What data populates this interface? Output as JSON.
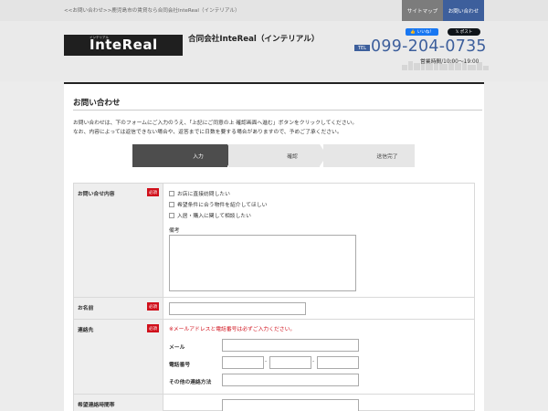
{
  "topbar": {
    "breadcrumb": "<<お問い合わせ>>鹿児島市の賃貸なら合同会社InteReal（インテリアル）",
    "sitemap_label": "サイトマップ",
    "contact_label": "お問い合わせ"
  },
  "header": {
    "logo_sub": "インテリアル",
    "logo_text": "InteReal",
    "company_name": "合同会社InteReal（インテリアル）",
    "fb_like": "いいね！",
    "x_post": "ポスト",
    "tel_badge": "TEL",
    "tel_number": "099-204-0735",
    "hours": "営業時間/10:00～19:00",
    "colors": {
      "accent": "#3d5f9c",
      "dark": "#1f1f1f"
    }
  },
  "main": {
    "title": "お問い合わせ",
    "intro_line1": "お問い合わせは、下のフォームにご入力のうえ、「上記にご同意の上 確認画面へ進む」ボタンをクリックしてください。",
    "intro_line2": "なお、内容によっては返信できない場合や、返答までに日数を要する場合がありますので、予めご了承ください。",
    "steps": [
      "入力",
      "確認",
      "送信完了"
    ]
  },
  "form": {
    "required_label": "必須",
    "inquiry": {
      "label": "お問い合せ内容",
      "options": [
        "お店に直接訪問したい",
        "希望条件に合う物件を紹介してほしい",
        "入居・購入に関して相談したい"
      ],
      "note_label": "備考"
    },
    "name": {
      "label": "お名前"
    },
    "contact": {
      "label": "連絡先",
      "notice": "※メールアドレスと電話番号は必ずご入力ください。",
      "email_label": "メール",
      "phone_label": "電話番号",
      "other_label": "その他の連絡方法",
      "phone_separator": "-"
    },
    "time": {
      "label": "希望連絡時間帯"
    }
  }
}
